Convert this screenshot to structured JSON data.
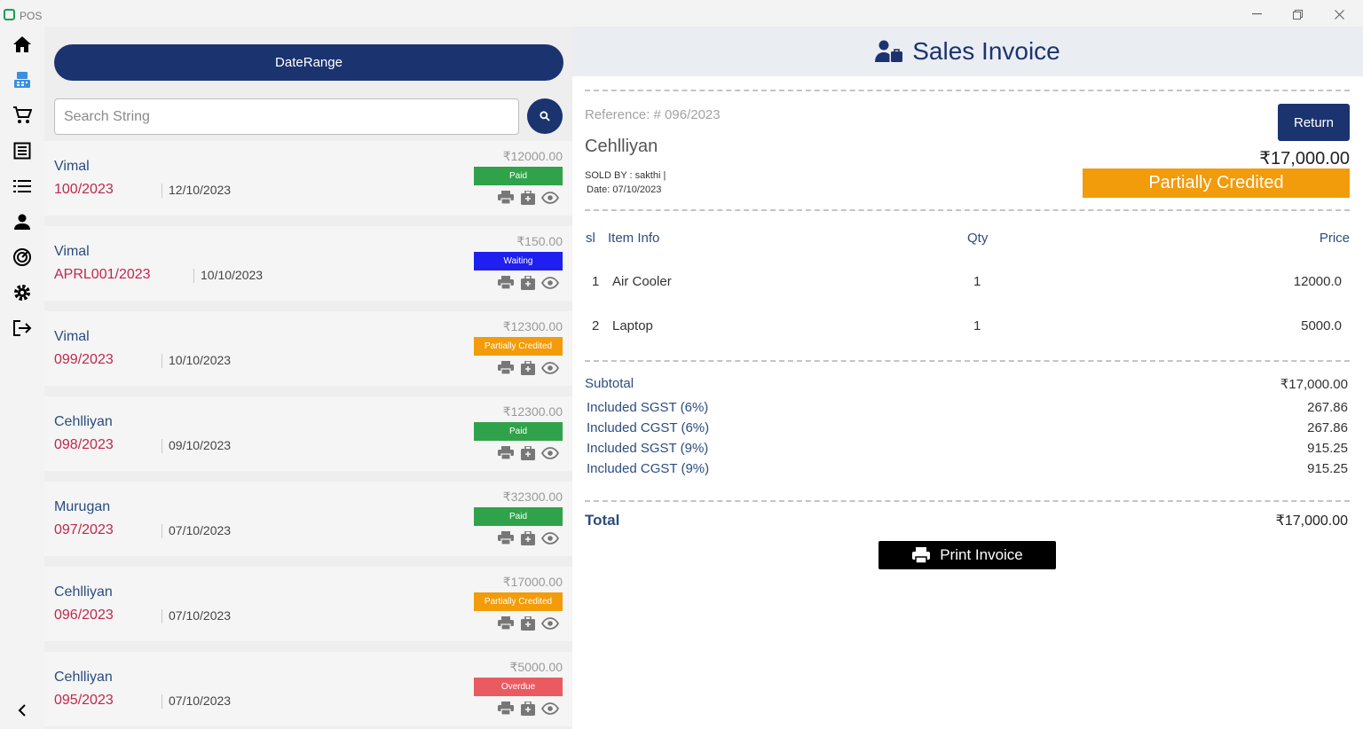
{
  "window": {
    "title": "POS"
  },
  "list": {
    "date_range_label": "DateRange",
    "search_placeholder": "Search String",
    "invoices": [
      {
        "customer": "Vimal",
        "ref": "100/2023",
        "date": "12/10/2023",
        "amount": "₹12000.00",
        "status": "Paid",
        "status_color": "#30a24a"
      },
      {
        "customer": "Vimal",
        "ref": "APRL001/2023",
        "date": "10/10/2023",
        "amount": "₹150.00",
        "status": "Waiting",
        "status_color": "#1f1ff0"
      },
      {
        "customer": "Vimal",
        "ref": "099/2023",
        "date": "10/10/2023",
        "amount": "₹12300.00",
        "status": "Partially Credited",
        "status_color": "#f29b0b"
      },
      {
        "customer": "Cehlliyan",
        "ref": "098/2023",
        "date": "09/10/2023",
        "amount": "₹12300.00",
        "status": "Paid",
        "status_color": "#30a24a"
      },
      {
        "customer": "Murugan",
        "ref": "097/2023",
        "date": "07/10/2023",
        "amount": "₹32300.00",
        "status": "Paid",
        "status_color": "#30a24a"
      },
      {
        "customer": "Cehlliyan",
        "ref": "096/2023",
        "date": "07/10/2023",
        "amount": "₹17000.00",
        "status": "Partially Credited",
        "status_color": "#f29b0b"
      },
      {
        "customer": "Cehlliyan",
        "ref": "095/2023",
        "date": "07/10/2023",
        "amount": "₹5000.00",
        "status": "Overdue",
        "status_color": "#ea5b61"
      }
    ]
  },
  "invoice": {
    "title": "Sales Invoice",
    "reference": "Reference: # 096/2023",
    "customer": "Cehlliyan",
    "sold_by": "SOLD BY : sakthi |",
    "date": "Date: 07/10/2023",
    "return_label": "Return",
    "amount": "₹17,000.00",
    "status": "Partially Credited",
    "columns": {
      "sl": "sl",
      "item": "Item Info",
      "qty": "Qty",
      "price": "Price"
    },
    "items": [
      {
        "sl": "1",
        "name": "Air Cooler",
        "qty": "1",
        "price": "12000.0"
      },
      {
        "sl": "2",
        "name": "Laptop",
        "qty": "1",
        "price": "5000.0"
      }
    ],
    "subtotal_label": "Subtotal",
    "subtotal": "₹17,000.00",
    "taxes": [
      {
        "label": "Included SGST (6%)",
        "value": "267.86"
      },
      {
        "label": "Included CGST (6%)",
        "value": "267.86"
      },
      {
        "label": "Included SGST (9%)",
        "value": "915.25"
      },
      {
        "label": "Included CGST (9%)",
        "value": "915.25"
      }
    ],
    "total_label": "Total",
    "total": "₹17,000.00",
    "print_label": "Print Invoice"
  },
  "colors": {
    "primary": "#1b3470",
    "partial": "#f29b0b",
    "paid": "#30a24a",
    "waiting": "#1f1ff0",
    "overdue": "#ea5b61"
  }
}
